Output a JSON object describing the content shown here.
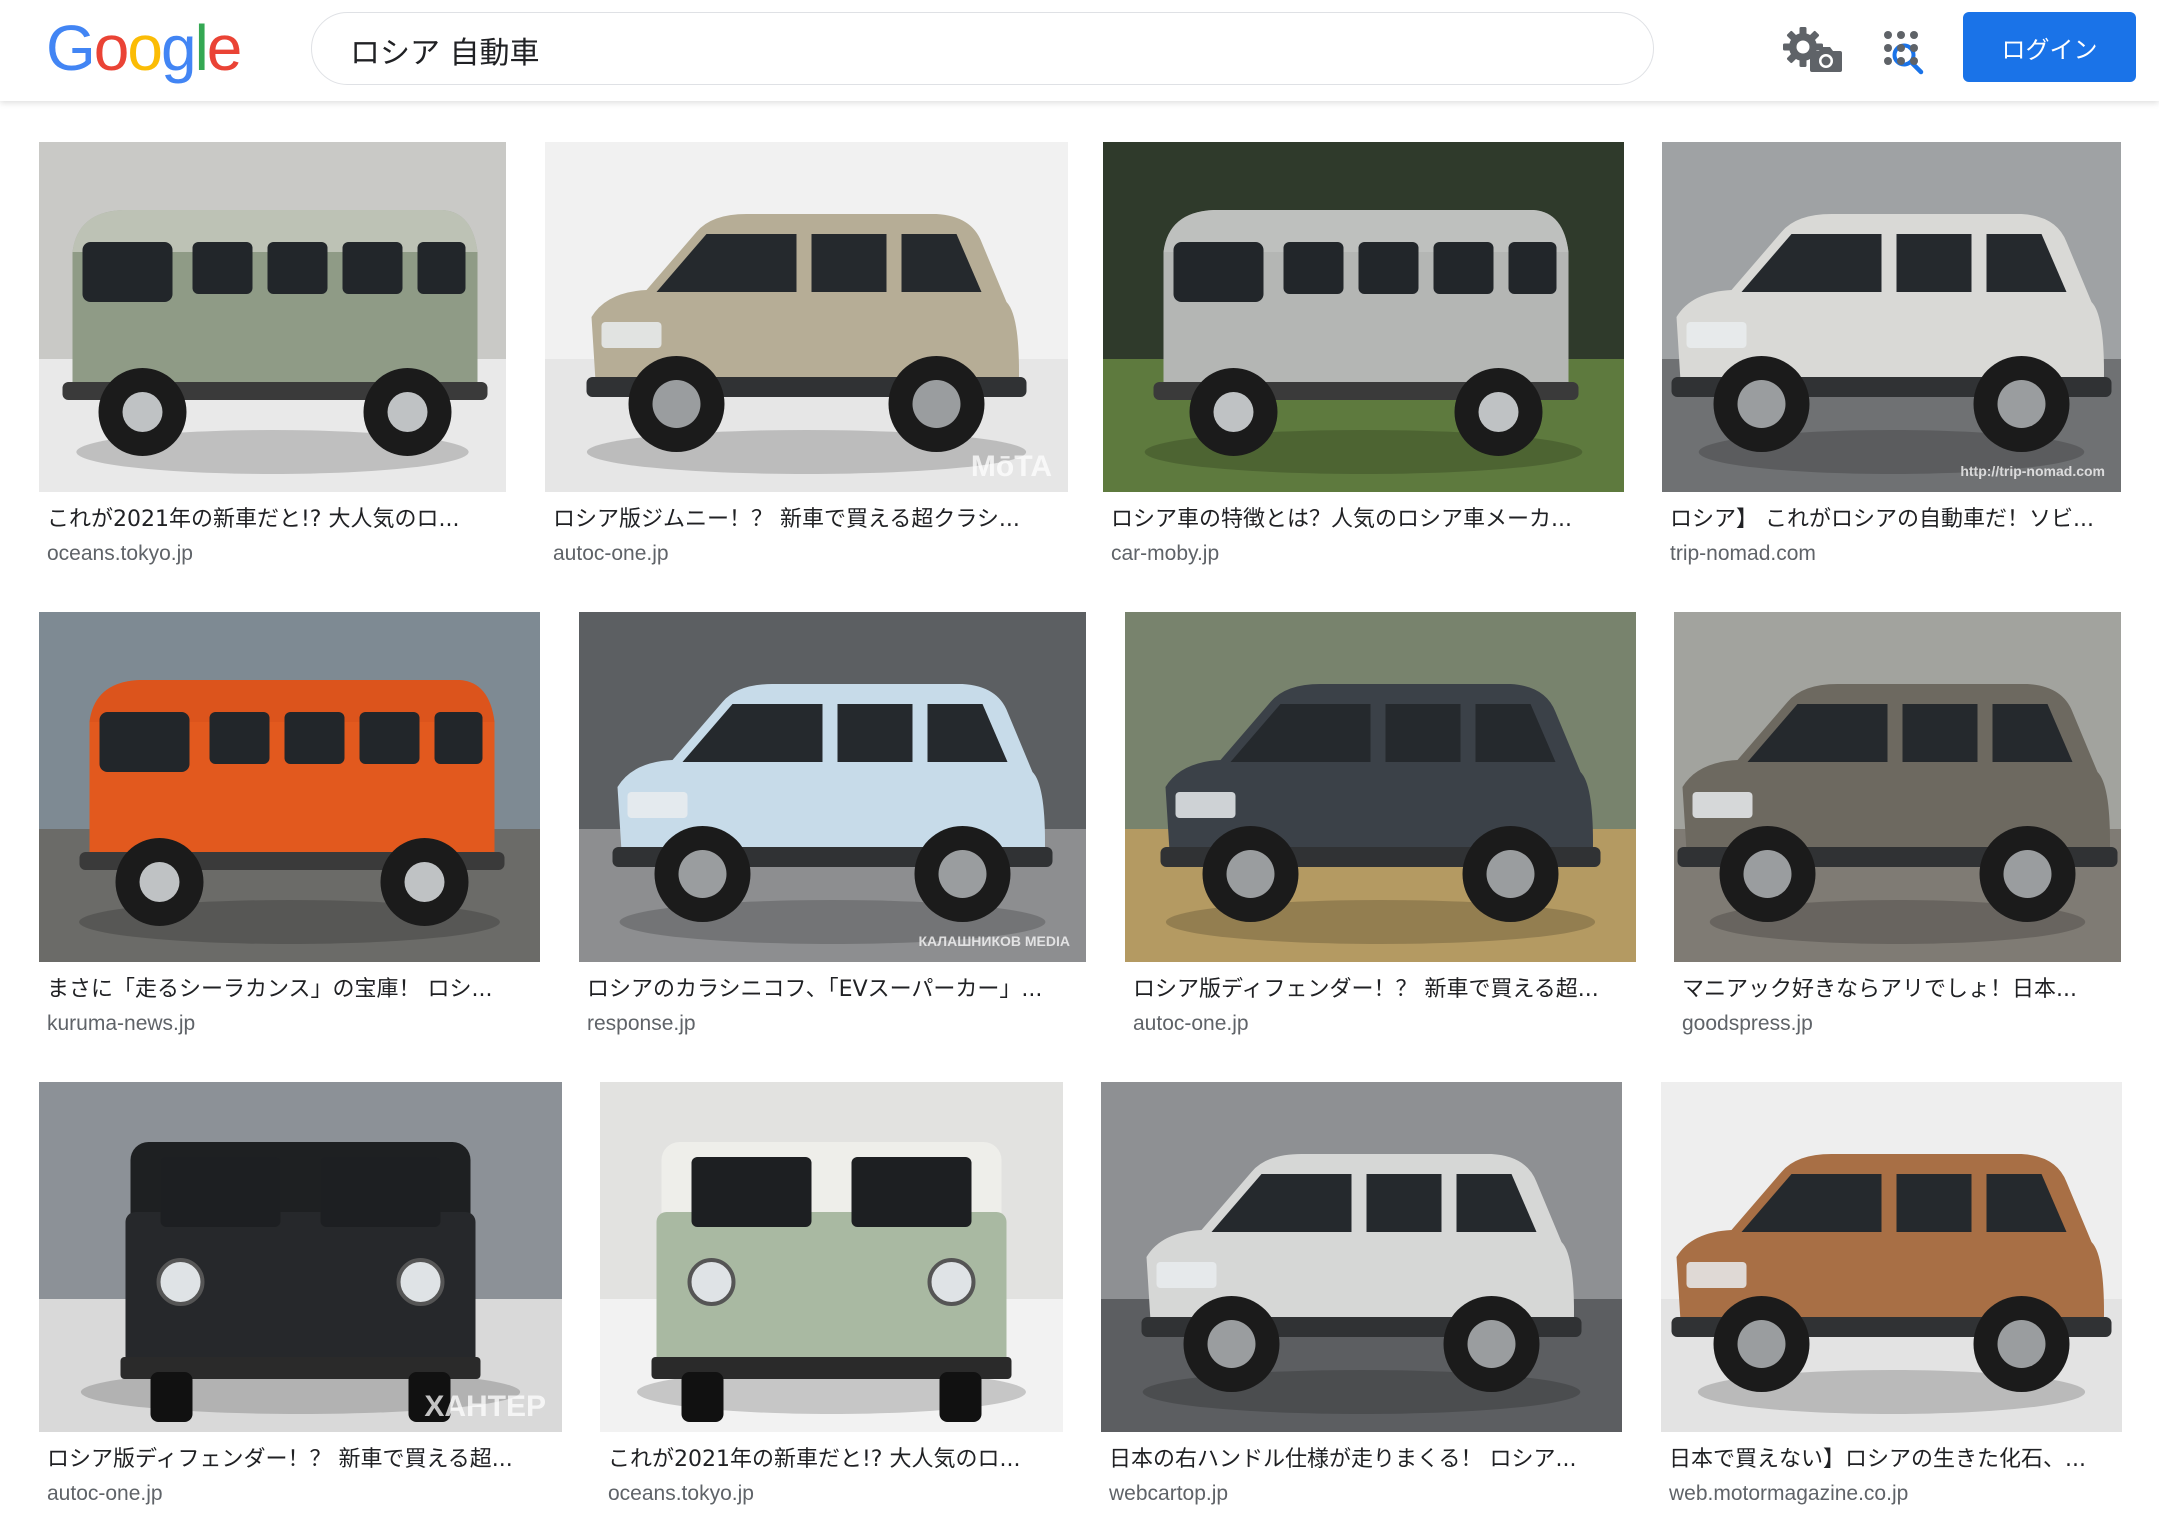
{
  "header": {
    "logo_letters": [
      {
        "char": "G",
        "color": "#4285F4"
      },
      {
        "char": "o",
        "color": "#EA4335"
      },
      {
        "char": "o",
        "color": "#FBBC05"
      },
      {
        "char": "g",
        "color": "#4285F4"
      },
      {
        "char": "l",
        "color": "#34A853"
      },
      {
        "char": "e",
        "color": "#EA4335"
      }
    ],
    "search_query": "ロシア 自動車",
    "camera_icon": "camera-icon",
    "search_icon": "search-icon",
    "settings_icon": "gear-icon",
    "apps_icon": "apps-grid-icon",
    "login_label": "ログイン",
    "accent_color": "#1a73e8"
  },
  "results": [
    {
      "caption": "これが2021年の新車だと!? 大人気のロ...",
      "domain": "oceans.tokyo.jp",
      "vehicle": "sage van",
      "bg": "#c9c9c6",
      "body": "#8f9b86",
      "roof": "#dcdcd6",
      "ground": "#e9e9e9"
    },
    {
      "caption": "ロシア版ジムニー！？ 新車で買える超クラシ...",
      "domain": "autoc-one.jp",
      "vehicle": "beige 4x4",
      "bg": "#f1f1f1",
      "body": "#b6ad96",
      "roof": "#b6ad96",
      "ground": "#e6e6e6",
      "watermark": "MōTA"
    },
    {
      "caption": "ロシア車の特徴とは？人気のロシア車メーカ...",
      "domain": "car-moby.jp",
      "vehicle": "grey van",
      "bg": "#2f3a2b",
      "body": "#b4b6b4",
      "roof": "#c4c6c4",
      "ground": "#5e7a3e"
    },
    {
      "caption": "ロシア】 これがロシアの自動車だ！ソビ...",
      "domain": "trip-nomad.com",
      "vehicle": "white sedan",
      "bg": "#9fa2a4",
      "body": "#d9d9d6",
      "roof": "#cfcfcc",
      "ground": "#6f7173",
      "watermark": "http://trip-nomad.com"
    },
    {
      "caption": "まさに「走るシーラカンス」の宝庫！ ロシ...",
      "domain": "kuruma-news.jp",
      "vehicle": "orange van",
      "bg": "#7e8a93",
      "body": "#e2591e",
      "roof": "#d8511a",
      "ground": "#6b6b68"
    },
    {
      "caption": "ロシアのカラシニコフ、「EVスーパーカー」...",
      "domain": "response.jp",
      "vehicle": "light blue concept",
      "bg": "#5c5f62",
      "body": "#c7dbe9",
      "roof": "#b9cfdf",
      "ground": "#8d8e90",
      "watermark": "КАЛАШНИКОВ MEDIA"
    },
    {
      "caption": "ロシア版ディフェンダー！？ 新車で買える超...",
      "domain": "autoc-one.jp",
      "vehicle": "dark suv",
      "bg": "#78836d",
      "body": "#3b4148",
      "roof": "#c7c9c9",
      "ground": "#b49a62"
    },
    {
      "caption": "マニアック好きならアリでしょ！日本...",
      "domain": "goodspress.jp",
      "vehicle": "grey 4x4",
      "bg": "#a2a39e",
      "body": "#6d6960",
      "roof": "#6d6960",
      "ground": "#7f7b74"
    },
    {
      "caption": "ロシア版ディフェンダー！？ 新車で買える超...",
      "domain": "autoc-one.jp",
      "vehicle": "black suv front",
      "bg": "#8c9197",
      "body": "#26282b",
      "roof": "#1e2022",
      "ground": "#d9d9d9",
      "watermark": "ХАНТЕР"
    },
    {
      "caption": "これが2021年の新車だと!? 大人気のロ...",
      "domain": "oceans.tokyo.jp",
      "vehicle": "sage van rear",
      "bg": "#e2e2e0",
      "body": "#a9b9a2",
      "roof": "#eeeeea",
      "ground": "#f2f2f2"
    },
    {
      "caption": "日本の右ハンドル仕様が走りまくる！ ロシア...",
      "domain": "webcartop.jp",
      "vehicle": "silver wagon",
      "bg": "#8e9093",
      "body": "#d6d7d6",
      "roof": "#cfd0cf",
      "ground": "#5c5e61"
    },
    {
      "caption": "日本で買えない】ロシアの生きた化石、...",
      "domain": "web.motormagazine.co.jp",
      "vehicle": "bronze 4x4",
      "bg": "#eeeeee",
      "body": "#a86f45",
      "roof": "#a86f45",
      "ground": "#e3e3e3"
    }
  ]
}
